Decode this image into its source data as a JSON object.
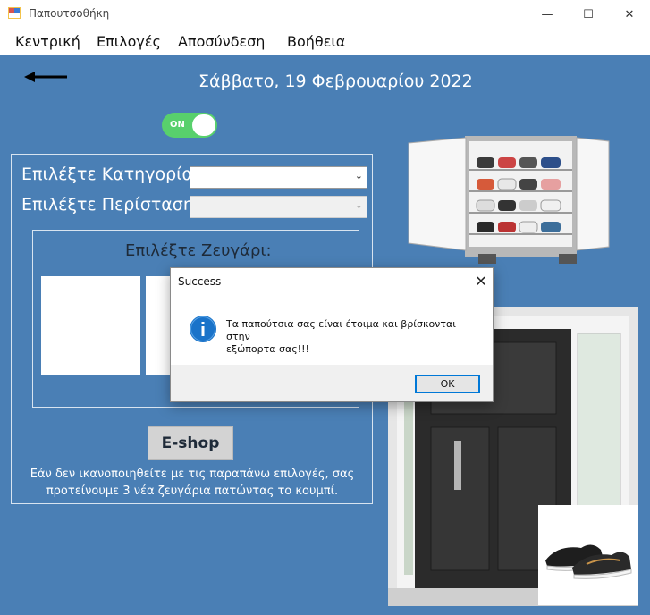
{
  "window": {
    "title": "Παπουτσοθήκη",
    "controls": {
      "minimize": "—",
      "maximize": "☐",
      "close": "✕"
    }
  },
  "menu": [
    "Κεντρική",
    "Επιλογές",
    "Αποσύνδεση",
    "Βοήθεια"
  ],
  "main": {
    "date": "Σάββατο, 19 Φεβρουαρίου 2022",
    "toggle_label": "ON",
    "category_label": "Επιλέξτε Κατηγορία:",
    "category_value": "",
    "occasion_label": "Επιλέξτε Περίσταση:",
    "occasion_value": "",
    "pair_title": "Επιλέξτε Ζευγάρι:",
    "eshop_button": "E-shop",
    "hint_line1": "Εάν δεν ικανοποιηθείτε με τις παραπάνω επιλογές, σας",
    "hint_line2": "προτείνουμε 3 νέα ζευγάρια πατώντας το κουμπί."
  },
  "dialog": {
    "title": "Success",
    "message_line1": "Τα παπούτσια σας είναι έτοιμα και βρίσκονται στην",
    "message_line2": "εξώπορτα σας!!!",
    "ok": "OK",
    "icon": "info-icon"
  },
  "colors": {
    "client_bg": "#4a7fb5",
    "toggle_on": "#58d06c",
    "accent": "#0078d7"
  }
}
